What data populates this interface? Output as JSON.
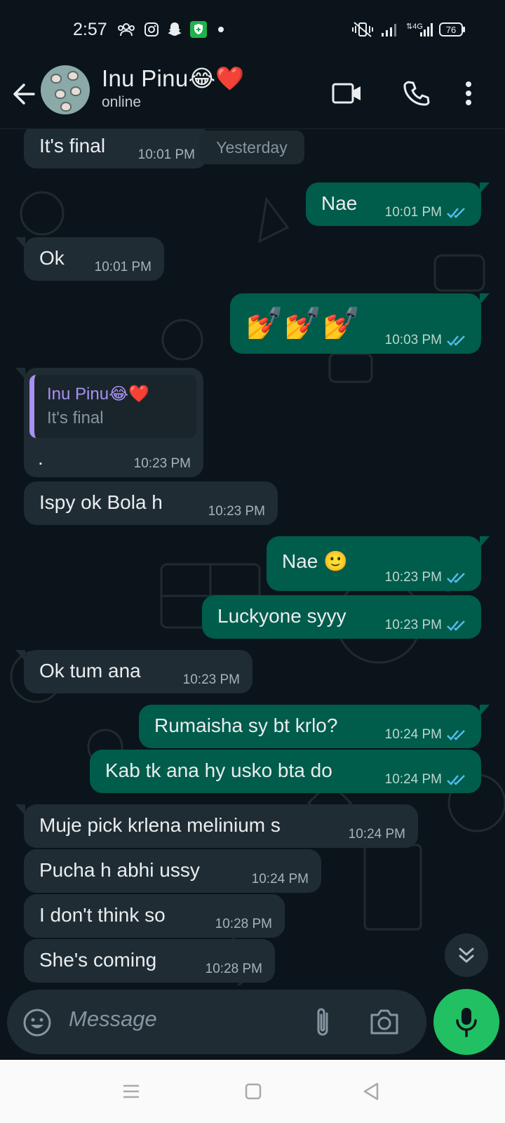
{
  "status_bar": {
    "time": "2:57",
    "network": "4G",
    "battery": "76",
    "icons": [
      "group-icon",
      "instagram-icon",
      "snapchat-icon",
      "vpn-shield-icon",
      "dot-icon",
      "vibrate-icon",
      "signal-icon",
      "4g-signal-icon",
      "battery-icon"
    ]
  },
  "header": {
    "contact_name": "Inu Pinu😂❤️",
    "status": "online",
    "icons": [
      "back-arrow-icon",
      "video-call-icon",
      "voice-call-icon",
      "more-vert-icon"
    ]
  },
  "chat": {
    "date_chip": "Yesterday",
    "messages": [
      {
        "dir": "in",
        "text": "It's final",
        "time": "10:01 PM"
      },
      {
        "dir": "out",
        "text": "Nae",
        "time": "10:01 PM"
      },
      {
        "dir": "in",
        "text": "Ok",
        "time": "10:01 PM"
      },
      {
        "dir": "out",
        "text": "💅💅💅",
        "time": "10:03 PM"
      },
      {
        "dir": "in",
        "reply_to": {
          "name": "Inu Pinu😂❤️",
          "text": "It's final"
        },
        "text": ".",
        "time": "10:23 PM"
      },
      {
        "dir": "in",
        "text": "Ispy ok Bola h",
        "time": "10:23 PM"
      },
      {
        "dir": "out",
        "text": "Nae 🙂",
        "time": "10:23 PM"
      },
      {
        "dir": "out",
        "text": "Luckyone syyy",
        "time": "10:23 PM"
      },
      {
        "dir": "in",
        "text": "Ok tum ana",
        "time": "10:23 PM"
      },
      {
        "dir": "out",
        "text": "Rumaisha sy bt krlo?",
        "time": "10:24 PM"
      },
      {
        "dir": "out",
        "text": "Kab tk ana hy usko bta do",
        "time": "10:24 PM"
      },
      {
        "dir": "in",
        "text": "Muje pick krlena melinium s",
        "time": "10:24 PM"
      },
      {
        "dir": "in",
        "text": "Pucha h abhi ussy",
        "time": "10:24 PM"
      },
      {
        "dir": "in",
        "text": "I don't think so",
        "time": "10:28 PM"
      },
      {
        "dir": "in",
        "text": "She's coming",
        "time": "10:28 PM"
      }
    ]
  },
  "composer": {
    "placeholder": "Message",
    "icons": [
      "emoji-icon",
      "attach-icon",
      "camera-icon",
      "mic-icon"
    ]
  },
  "colors": {
    "background": "#0b141a",
    "incoming_bubble": "#202c33",
    "outgoing_bubble": "#005c4b",
    "read_ticks": "#53bdeb",
    "accent_green": "#21c063"
  }
}
